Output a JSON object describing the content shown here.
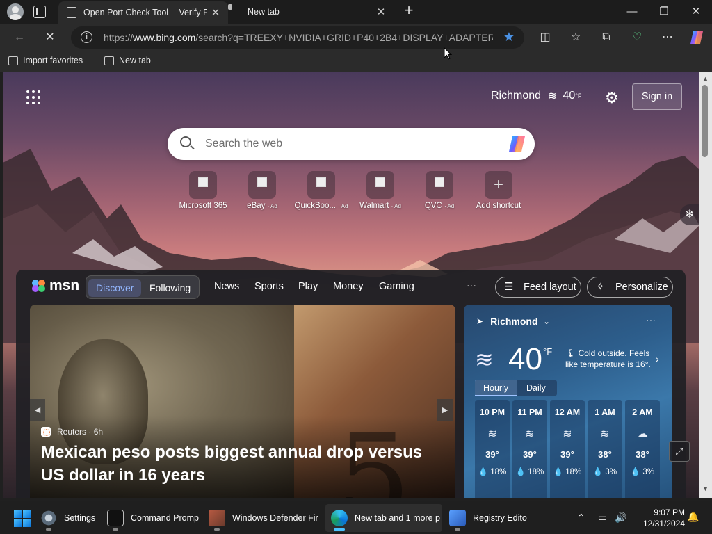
{
  "window": {
    "tabs": [
      {
        "title": "Open Port Check Tool -- Verify Po",
        "active": true
      },
      {
        "title": "New tab",
        "active": false
      }
    ],
    "new_tab_symbol": "+",
    "close_symbol": "✕",
    "controls": {
      "minimize": "—",
      "restore": "❐",
      "close": "✕"
    }
  },
  "toolbar": {
    "back_symbol": "←",
    "stop_symbol": "✕",
    "url_prefix": "https://",
    "url_host": "www.bing.com",
    "url_rest": "/search?q=TREEXY+NVIDIA+GRID+P40+2B4+DISPLAY+ADAPTER...",
    "info_symbol": "i",
    "favorite_star": "★",
    "split_screen_symbol": "◫",
    "favorites_symbol": "☆",
    "collections_symbol": "⧉",
    "performance_symbol": "♡",
    "more_symbol": "⋯"
  },
  "favorites_bar": {
    "items": [
      {
        "label": "Import favorites"
      },
      {
        "label": "New tab"
      }
    ]
  },
  "page": {
    "location": "Richmond",
    "temperature": "40",
    "temp_unit": "°F",
    "wind_symbol": "≋",
    "settings_symbol": "⚙",
    "sign_in": "Sign in",
    "search_placeholder": "Search the web",
    "shortcuts": [
      {
        "label": "Microsoft 365",
        "ad": ""
      },
      {
        "label": "eBay",
        "ad": "· Ad"
      },
      {
        "label": "QuickBoo...",
        "ad": "· Ad"
      },
      {
        "label": "Walmart",
        "ad": "· Ad"
      },
      {
        "label": "QVC",
        "ad": "· Ad"
      },
      {
        "label": "Add shortcut",
        "ad": ""
      }
    ],
    "add_symbol": "+",
    "side_symbol": "❄"
  },
  "feed": {
    "brand": "msn",
    "segments": [
      "Discover",
      "Following"
    ],
    "nav": [
      "News",
      "Sports",
      "Play",
      "Money",
      "Gaming"
    ],
    "more": "···",
    "feed_layout": "Feed layout",
    "personalize": "Personalize",
    "feed_layout_icon": "☰",
    "personalize_icon": "✧",
    "hero": {
      "source": "Reuters",
      "age": "· 6h",
      "headline": "Mexican peso posts biggest annual drop versus US dollar in 16 years",
      "prev": "◀",
      "next": "▶",
      "bill_number": "5"
    },
    "expand_symbol": "⤢"
  },
  "weather": {
    "location": "Richmond",
    "nav_symbol": "➤",
    "chevron": "⌄",
    "more": "···",
    "temperature": "40",
    "unit": "°F",
    "condition": "Cold outside. Feels like temperature is 16°.",
    "thermometer": "🌡",
    "arrow": "›",
    "tabs": [
      "Hourly",
      "Daily"
    ],
    "hourly": [
      {
        "time": "10 PM",
        "icon": "≋",
        "temp": "39°",
        "rain": "💧 18%"
      },
      {
        "time": "11 PM",
        "icon": "≋",
        "temp": "39°",
        "rain": "💧 18%"
      },
      {
        "time": "12 AM",
        "icon": "≋",
        "temp": "39°",
        "rain": "💧 18%"
      },
      {
        "time": "1 AM",
        "icon": "≋",
        "temp": "38°",
        "rain": "💧 3%"
      },
      {
        "time": "2 AM",
        "icon": "☁",
        "temp": "38°",
        "rain": "💧 3%"
      }
    ]
  },
  "taskbar": {
    "apps": [
      {
        "label": "Settings",
        "icon": "gear-icon",
        "color": "#5a6a7a"
      },
      {
        "label": "Command Promp",
        "icon": "terminal-icon",
        "color": "#2b2b2b"
      },
      {
        "label": "Windows Defender Fir",
        "icon": "firewall-icon",
        "color": "#8a4a3a"
      },
      {
        "label": "New tab and 1 more p",
        "icon": "edge-icon",
        "color": "#0a74da"
      },
      {
        "label": "Registry Edito",
        "icon": "registry-icon",
        "color": "#2a6ac8"
      }
    ],
    "tray": {
      "chevron": "⌃",
      "network": "▭",
      "volume": "🔊"
    },
    "time": "9:07 PM",
    "date": "12/31/2024",
    "notification": "🔔"
  }
}
